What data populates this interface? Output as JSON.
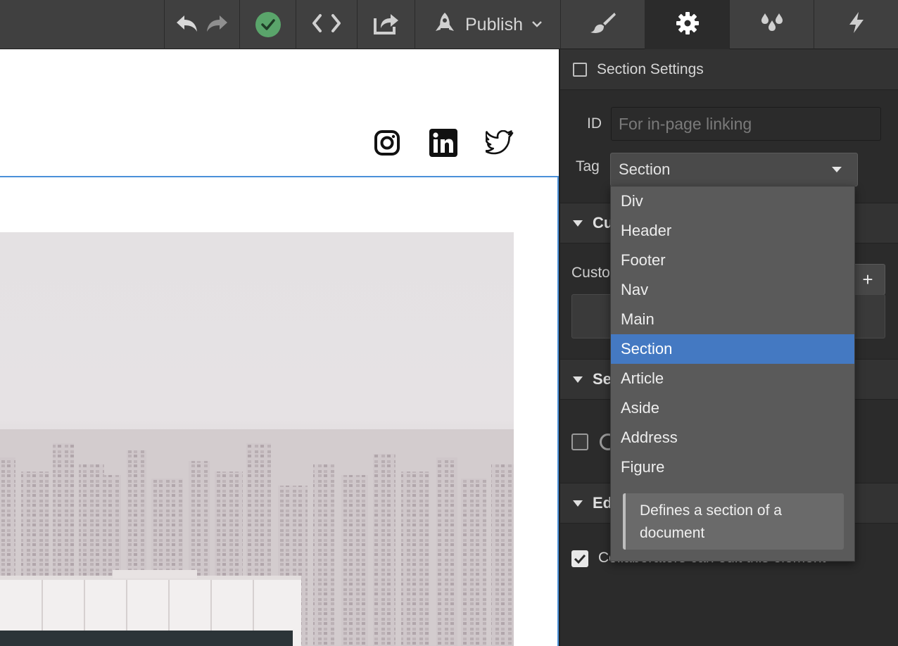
{
  "toolbar": {
    "publish_label": "Publish"
  },
  "panel_tabs": [
    "style-tab",
    "settings-tab",
    "interactions-tab",
    "ecommerce-tab"
  ],
  "panel": {
    "section_settings_label": "Section Settings",
    "id_label": "ID",
    "id_placeholder": "For in-page linking",
    "tag_label": "Tag",
    "tag_value": "Section",
    "custom_section_visible": "Cu",
    "custom_attr_visible": "Custo",
    "search_section_visible": "Se",
    "editor_section_visible": "Ed",
    "plus_label": "+",
    "collab_label": "Collaborators can edit this element"
  },
  "dropdown": {
    "items": [
      "Div",
      "Header",
      "Footer",
      "Nav",
      "Main",
      "Section",
      "Article",
      "Aside",
      "Address",
      "Figure"
    ],
    "selected": "Section",
    "tooltip_line1": "Defines a section of a",
    "tooltip_line2": "document"
  },
  "colors": {
    "accent": "#4479c2",
    "success": "#5aa56b",
    "selection_outline": "#4a90d9"
  }
}
